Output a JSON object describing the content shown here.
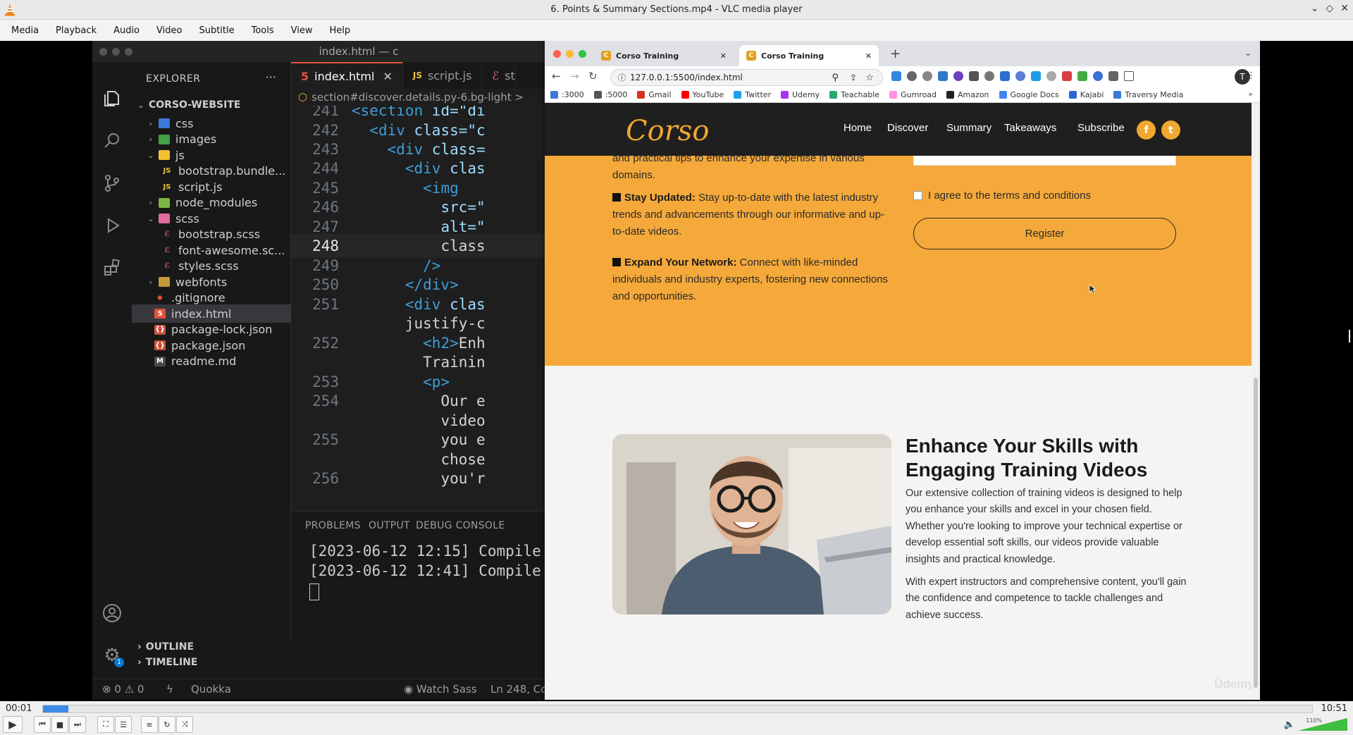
{
  "window": {
    "title": "6. Points & Summary Sections.mp4 - VLC media player"
  },
  "menu": [
    "Media",
    "Playback",
    "Audio",
    "Video",
    "Subtitle",
    "Tools",
    "View",
    "Help"
  ],
  "vscode": {
    "title": "index.html — c",
    "explorer_title": "EXPLORER",
    "project": "CORSO-WEBSITE",
    "tree": [
      {
        "label": "css",
        "type": "folder",
        "icon_color": "#3c78d8"
      },
      {
        "label": "images",
        "type": "folder",
        "icon_color": "#43a047"
      },
      {
        "label": "js",
        "type": "folder-open",
        "icon_color": "#f1c232"
      },
      {
        "label": "bootstrap.bundle...",
        "type": "js"
      },
      {
        "label": "script.js",
        "type": "js"
      },
      {
        "label": "node_modules",
        "type": "folder",
        "icon_color": "#7cb342"
      },
      {
        "label": "scss",
        "type": "folder-open",
        "icon_color": "#e06c9f"
      },
      {
        "label": "bootstrap.scss",
        "type": "scss"
      },
      {
        "label": "font-awesome.sc...",
        "type": "scss"
      },
      {
        "label": "styles.scss",
        "type": "scss"
      },
      {
        "label": "webfonts",
        "type": "folder",
        "icon_color": "#c49a3a"
      },
      {
        "label": ".gitignore",
        "type": "git"
      },
      {
        "label": "index.html",
        "type": "html",
        "selected": true
      },
      {
        "label": "package-lock.json",
        "type": "json"
      },
      {
        "label": "package.json",
        "type": "json"
      },
      {
        "label": "readme.md",
        "type": "md"
      }
    ],
    "tabs": [
      {
        "label": "index.html",
        "active": true
      },
      {
        "label": "script.js",
        "active": false
      },
      {
        "label": "st",
        "active": false
      }
    ],
    "breadcrumb": "section#discover.details.py-6.bg-light >",
    "code": [
      {
        "n": "241",
        "text": "<section id=\"di"
      },
      {
        "n": "242",
        "text": "  <div class=\"c"
      },
      {
        "n": "243",
        "text": "    <div class="
      },
      {
        "n": "244",
        "text": "      <div clas"
      },
      {
        "n": "245",
        "text": "        <img"
      },
      {
        "n": "246",
        "text": "          src=\""
      },
      {
        "n": "247",
        "text": "          alt=\""
      },
      {
        "n": "248",
        "text": "          class",
        "current": true
      },
      {
        "n": "249",
        "text": "        />"
      },
      {
        "n": "250",
        "text": "      </div>"
      },
      {
        "n": "251",
        "text": "      <div clas"
      },
      {
        "n": "",
        "text": "      justify-c"
      },
      {
        "n": "252",
        "text": "        <h2>Enh"
      },
      {
        "n": "",
        "text": "        Trainin"
      },
      {
        "n": "253",
        "text": "        <p>"
      },
      {
        "n": "254",
        "text": "          Our e"
      },
      {
        "n": "",
        "text": "          video"
      },
      {
        "n": "255",
        "text": "          you e"
      },
      {
        "n": "",
        "text": "          chose"
      },
      {
        "n": "256",
        "text": "          you'r"
      }
    ],
    "panel_tabs": [
      "PROBLEMS",
      "OUTPUT",
      "DEBUG CONSOLE"
    ],
    "panel_lines": [
      "[2023-06-12 12:15] Compile",
      "[2023-06-12 12:41] Compile"
    ],
    "outline": "OUTLINE",
    "timeline": "TIMELINE",
    "status": {
      "errors": "0",
      "warnings": "0",
      "quokka": "Quokka",
      "watch": "Watch Sass",
      "position": "Ln 248, Co"
    },
    "settings_badge": "1"
  },
  "browser": {
    "tabs": [
      "Corso Training",
      "Corso Training"
    ],
    "url": "127.0.0.1:5500/index.html",
    "avatar": "T",
    "bookmarks": [
      {
        "label": ":3000",
        "color": "#3c78d8"
      },
      {
        "label": ":5000",
        "color": "#555"
      },
      {
        "label": "Gmail",
        "color": "#d93025"
      },
      {
        "label": "YouTube",
        "color": "#ff0000"
      },
      {
        "label": "Twitter",
        "color": "#1da1f2"
      },
      {
        "label": "Udemy",
        "color": "#a435f0"
      },
      {
        "label": "Teachable",
        "color": "#27a86b"
      },
      {
        "label": "Gumroad",
        "color": "#ff90e8"
      },
      {
        "label": "Amazon",
        "color": "#222"
      },
      {
        "label": "Google Docs",
        "color": "#4285f4"
      },
      {
        "label": "Kajabi",
        "color": "#2e64d8"
      },
      {
        "label": "Traversy Media",
        "color": "#3c78d8"
      }
    ]
  },
  "site": {
    "logo": "Corso",
    "nav": [
      "Home",
      "Discover",
      "Summary",
      "Takeaways",
      "Subscribe"
    ],
    "social": [
      "f",
      "t"
    ],
    "intro_tail_1": "and practical tips to enhance your expertise in various",
    "intro_tail_2": "domains.",
    "bullets": [
      {
        "title": "Stay Updated:",
        "text": "Stay up-to-date with the latest industry trends and advancements through our informative and up-to-date videos."
      },
      {
        "title": "Expand Your Network:",
        "text": "Connect with like-minded individuals and industry experts, fostering new connections and opportunities."
      }
    ],
    "agree": "I agree to the terms and conditions",
    "register": "Register",
    "heading": "Enhance Your Skills with Engaging Training Videos",
    "para1": "Our extensive collection of training videos is designed to help you enhance your skills and excel in your chosen field. Whether you're looking to improve your technical expertise or develop essential soft skills, our videos provide valuable insights and practical knowledge.",
    "para2": "With expert instructors and comprehensive content, you'll gain the confidence and competence to tackle challenges and achieve success.",
    "watermark": "Ūdemy"
  },
  "player": {
    "current": "00:01",
    "total": "10:51",
    "progress": 0.0015,
    "volume_label": "110%",
    "volume": 1.0
  }
}
